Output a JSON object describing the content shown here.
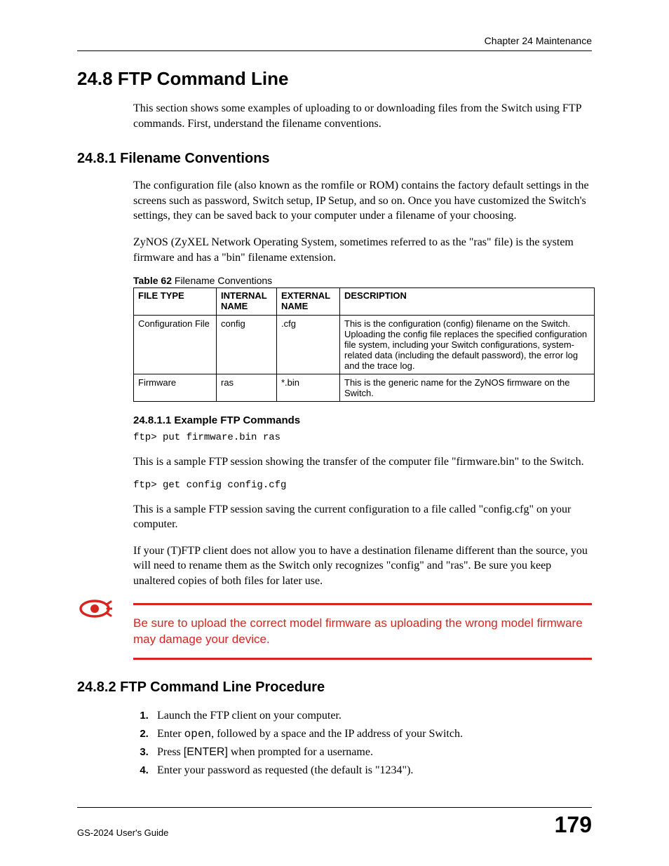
{
  "header": {
    "chapter_label": "Chapter 24 Maintenance"
  },
  "section_24_8": {
    "heading": "24.8  FTP Command Line",
    "intro": "This section shows some examples of uploading to or downloading files from the Switch using FTP commands. First, understand the filename conventions."
  },
  "section_24_8_1": {
    "heading": "24.8.1  Filename Conventions",
    "para1": "The configuration file (also known as the romfile or ROM) contains the factory default settings in the screens such as password, Switch setup, IP Setup, and so on. Once you have customized the Switch's settings, they can be saved back to your computer under a filename of your choosing.",
    "para2": "ZyNOS (ZyXEL Network Operating System, sometimes referred to as the \"ras\" file) is the system firmware and has a \"bin\" filename extension."
  },
  "table62": {
    "caption_bold": "Table 62",
    "caption_rest": "   Filename Conventions",
    "headers": {
      "c0": "FILE TYPE",
      "c1": "INTERNAL NAME",
      "c2": "EXTERNAL NAME",
      "c3": "DESCRIPTION"
    },
    "rows": [
      {
        "c0": "Configuration File",
        "c1": "config",
        "c2": ".cfg",
        "c3": "This is the configuration (config) filename on the Switch. Uploading the config file replaces the specified configuration file system, including your Switch configurations, system-related data (including the default password), the error log and the trace log."
      },
      {
        "c0": "Firmware",
        "c1": "ras",
        "c2": "*.bin",
        "c3": "This is the generic name for the ZyNOS firmware on the Switch."
      }
    ]
  },
  "section_24_8_1_1": {
    "heading": "24.8.1.1  Example FTP Commands",
    "code1": "ftp> put firmware.bin ras",
    "para1": "This is a sample FTP session showing the transfer of the computer file \"firmware.bin\" to the Switch.",
    "code2": "ftp> get config config.cfg",
    "para2": "This is a sample FTP session saving the current configuration to a file called \"config.cfg\" on your computer.",
    "para3": "If your (T)FTP client does not allow you to have a destination filename different than the source, you will need to rename them as the Switch only recognizes \"config\" and \"ras\". Be sure you keep unaltered copies of both files for later use."
  },
  "warning": {
    "text": "Be sure to upload the correct model firmware as uploading the wrong model firmware may damage your device."
  },
  "section_24_8_2": {
    "heading": "24.8.2  FTP Command Line Procedure",
    "steps": {
      "s1": "Launch the FTP client on your computer.",
      "s2a": "Enter ",
      "s2b": "open",
      "s2c": ", followed by a space and the IP address of your Switch.",
      "s3a": "Press ",
      "s3b": "[ENTER]",
      "s3c": " when prompted for a username.",
      "s4": "Enter your password as requested (the default is \"1234\")."
    }
  },
  "footer": {
    "guide": "GS-2024 User's Guide",
    "page_number": "179"
  }
}
